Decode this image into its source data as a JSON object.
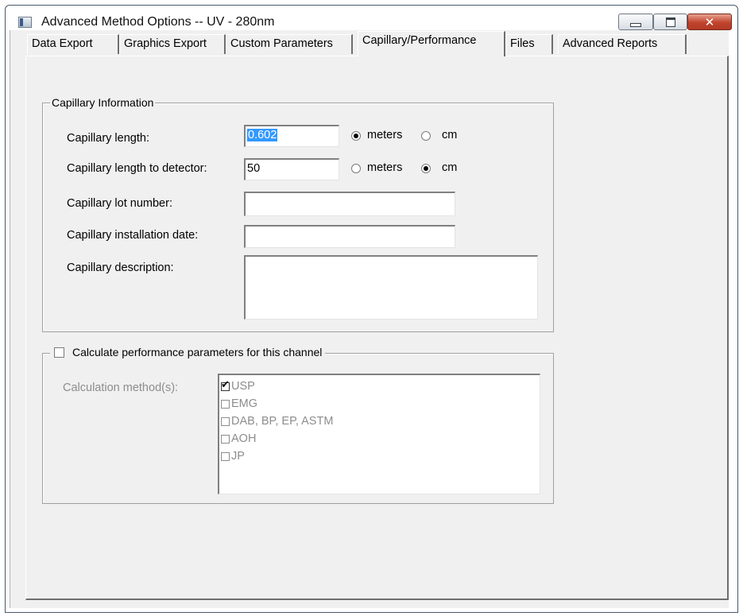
{
  "window": {
    "title": "Advanced Method Options -- UV - 280nm"
  },
  "tabs": [
    {
      "label": "Data Export",
      "active": false
    },
    {
      "label": "Graphics Export",
      "active": false
    },
    {
      "label": "Custom Parameters",
      "active": false
    },
    {
      "label": "Capillary/Performance",
      "active": true
    },
    {
      "label": "Files",
      "active": false
    },
    {
      "label": "Advanced Reports",
      "active": false
    }
  ],
  "capillary_info": {
    "group_label": "Capillary Information",
    "length": {
      "label": "Capillary length:",
      "value": "0.602",
      "unit_options": [
        "meters",
        "cm"
      ],
      "selected_unit": "meters"
    },
    "length_to_detector": {
      "label": "Capillary length to detector:",
      "value": "50",
      "unit_options": [
        "meters",
        "cm"
      ],
      "selected_unit": "cm"
    },
    "lot_number": {
      "label": "Capillary lot number:",
      "value": ""
    },
    "installation_date": {
      "label": "Capillary installation date:",
      "value": ""
    },
    "description": {
      "label": "Capillary description:",
      "value": ""
    }
  },
  "performance": {
    "checkbox_label": "Calculate performance parameters for this channel",
    "checked": false,
    "methods_label": "Calculation method(s):",
    "methods": [
      {
        "label": "USP",
        "checked": true
      },
      {
        "label": "EMG",
        "checked": false
      },
      {
        "label": "DAB, BP, EP, ASTM",
        "checked": false
      },
      {
        "label": "AOH",
        "checked": false
      },
      {
        "label": "JP",
        "checked": false
      }
    ]
  },
  "colors": {
    "selection": "#3399ff",
    "close_button": "#c0432d",
    "dialog_background": "#f0f0f0",
    "disabled_text": "#8d8d8d"
  }
}
